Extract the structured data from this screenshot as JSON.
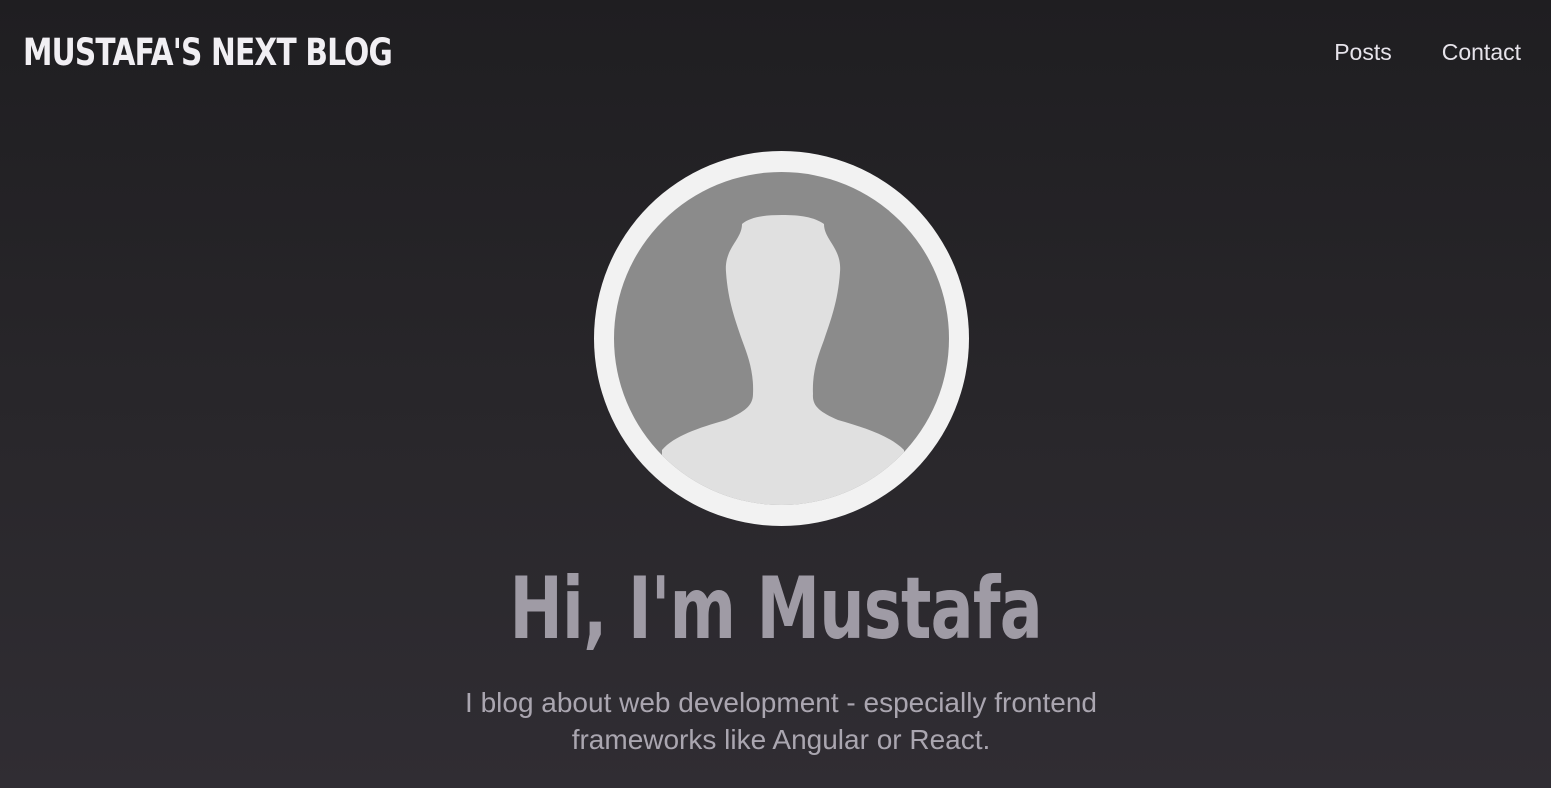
{
  "header": {
    "logo": "MUSTAFA'S NEXT BLOG",
    "nav": [
      {
        "label": "Posts"
      },
      {
        "label": "Contact"
      }
    ]
  },
  "hero": {
    "avatar_icon": "user-silhouette-icon",
    "headline": "Hi, I'm Mustafa",
    "tagline": "I blog about web development - especially frontend frameworks like Angular or React."
  },
  "colors": {
    "background_top": "#1f1e21",
    "background_bottom": "#302d33",
    "logo": "#f1eff3",
    "nav_text": "#e6e3ea",
    "headline": "#9f9ba5",
    "tagline": "#aaa6b0",
    "avatar_ring": "#f2f2f2",
    "avatar_bg": "#8b8b8b",
    "avatar_silhouette": "#e0e0e0"
  }
}
